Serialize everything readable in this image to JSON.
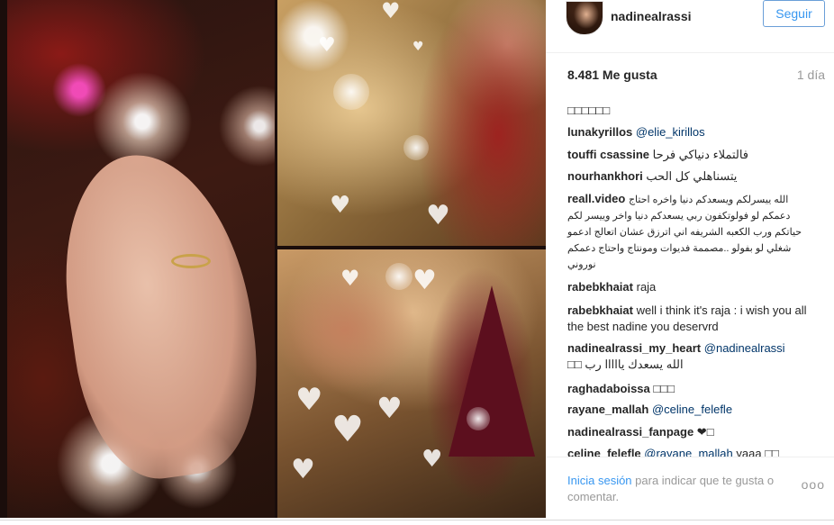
{
  "post": {
    "username": "nadinealrassi",
    "follow_label": "Seguir",
    "likes": "8.481 Me gusta",
    "time": "1 día"
  },
  "comments": {
    "partial_top": "□□□□□□",
    "items": [
      {
        "user": "lunakyrillos",
        "text": "",
        "mention": "@elie_kirillos"
      },
      {
        "user": "touffi csassine",
        "text": "فالتملاء دنياكي فرحا",
        "mention": ""
      },
      {
        "user": "nourhankhori",
        "text": "يتسناهلي كل الحب",
        "mention": ""
      },
      {
        "user": "reall.video",
        "text": "الله ييسرلكم ويسعدكم دنيا واخره احتاج دعمكم لو فولوتكفون ربي يسعدكم دنيا واخر وييسر لكم حياتكم ورب الكعبه الشريفه اني اترزق عشان اتعالج ادعمو شغلي لو بفولو ..مصممة فديوات ومونتاج واحتاج دعمكم نوروني",
        "mention": ""
      },
      {
        "user": "rabebkhaiat",
        "text": "raja",
        "mention": ""
      },
      {
        "user": "rabebkhaiat",
        "text": "well i think it's raja : i wish you all the best nadine you deservrd",
        "mention": ""
      },
      {
        "user": "nadinealrassi_my_heart",
        "text": "الله يسعدك يااااا رب □□",
        "mention": "@nadinealrassi"
      },
      {
        "user": "raghadaboissa",
        "text": "□□□",
        "mention": ""
      },
      {
        "user": "rayane_mallah",
        "text": "",
        "mention": "@celine_felefle"
      },
      {
        "user": "nadinealrassi_fanpage",
        "text": "❤□",
        "mention": ""
      },
      {
        "user": "celine_felefle",
        "text": "yaaa □□",
        "mention": "@rayane_mallah"
      }
    ]
  },
  "footer": {
    "login_link": "Inicia sesión",
    "login_text": " para indicar que te gusta o comentar.",
    "more_label": "ooo"
  }
}
